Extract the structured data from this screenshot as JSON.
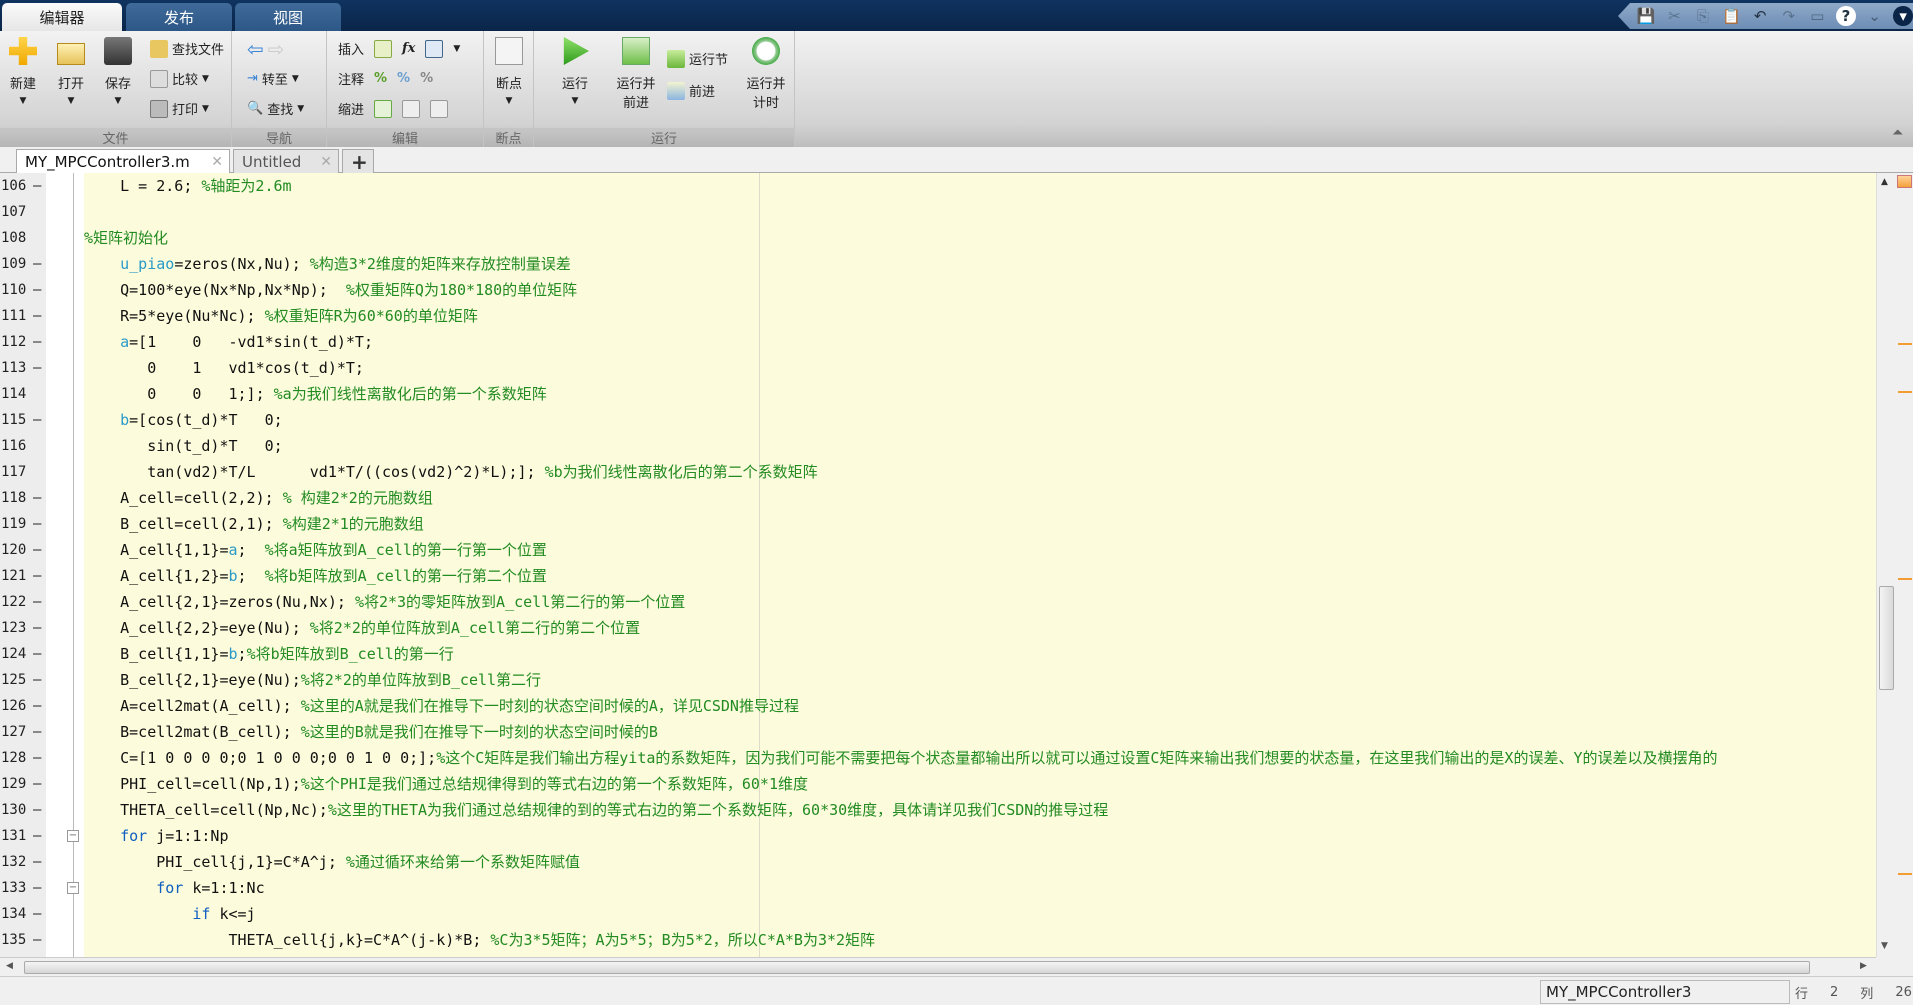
{
  "main_tabs": [
    "编辑器",
    "发布",
    "视图"
  ],
  "ribbon": {
    "file": {
      "label": "文件",
      "new": "新建",
      "open": "打开",
      "save": "保存",
      "find_files": "查找文件",
      "compare": "比较",
      "print": "打印"
    },
    "nav": {
      "label": "导航",
      "goto": "转至",
      "find": "查找"
    },
    "edit": {
      "label": "编辑",
      "insert": "插入",
      "comment": "注释",
      "indent": "缩进",
      "fx": "fx"
    },
    "breakpoints": {
      "label": "断点",
      "breakpoints": "断点"
    },
    "run": {
      "label": "运行",
      "run": "运行",
      "run_advance_1": "运行并",
      "run_advance_2": "前进",
      "run_section": "运行节",
      "advance": "前进",
      "run_time_1": "运行并",
      "run_time_2": "计时"
    }
  },
  "doc_tabs": [
    {
      "label": "MY_MPCController3.m",
      "active": true
    },
    {
      "label": "Untitled",
      "active": false
    }
  ],
  "add_tab": "+",
  "code_lines": [
    {
      "n": "106",
      "dash": true,
      "seg": [
        [
          "    L = 2.6; ",
          "code"
        ],
        [
          "%轴距为2.6m",
          "comment"
        ]
      ]
    },
    {
      "n": "107",
      "dash": false,
      "seg": []
    },
    {
      "n": "108",
      "dash": false,
      "seg": [
        [
          "%矩阵初始化",
          "comment"
        ]
      ]
    },
    {
      "n": "109",
      "dash": true,
      "seg": [
        [
          "    ",
          "code"
        ],
        [
          "u_piao",
          "var"
        ],
        [
          "=zeros(Nx,Nu); ",
          "code"
        ],
        [
          "%构造3*2维度的矩阵来存放控制量误差",
          "comment"
        ]
      ]
    },
    {
      "n": "110",
      "dash": true,
      "seg": [
        [
          "    Q=100*eye(Nx*Np,Nx*Np);  ",
          "code"
        ],
        [
          "%权重矩阵Q为180*180的单位矩阵",
          "comment"
        ]
      ]
    },
    {
      "n": "111",
      "dash": true,
      "seg": [
        [
          "    R=5*eye(Nu*Nc); ",
          "code"
        ],
        [
          "%权重矩阵R为60*60的单位矩阵",
          "comment"
        ]
      ]
    },
    {
      "n": "112",
      "dash": true,
      "seg": [
        [
          "    ",
          "code"
        ],
        [
          "a",
          "var"
        ],
        [
          "=[1    0   -vd1*sin(t_d)*T;",
          "code"
        ]
      ]
    },
    {
      "n": "113",
      "dash": true,
      "seg": [
        [
          "       0    1   vd1*cos(t_d)*T;",
          "code"
        ]
      ]
    },
    {
      "n": "114",
      "dash": false,
      "seg": [
        [
          "       0    0   1;]; ",
          "code"
        ],
        [
          "%a为我们线性离散化后的第一个系数矩阵",
          "comment"
        ]
      ]
    },
    {
      "n": "115",
      "dash": true,
      "seg": [
        [
          "    ",
          "code"
        ],
        [
          "b",
          "var"
        ],
        [
          "=[cos(t_d)*T   0;",
          "code"
        ]
      ]
    },
    {
      "n": "116",
      "dash": false,
      "seg": [
        [
          "       sin(t_d)*T   0;",
          "code"
        ]
      ]
    },
    {
      "n": "117",
      "dash": false,
      "seg": [
        [
          "       tan(vd2)*T/L      vd1*T/((cos(vd2)^2)*L);]; ",
          "code"
        ],
        [
          "%b为我们线性离散化后的第二个系数矩阵",
          "comment"
        ]
      ]
    },
    {
      "n": "118",
      "dash": true,
      "seg": [
        [
          "    A_cell=cell(2,2); ",
          "code"
        ],
        [
          "% 构建2*2的元胞数组",
          "comment"
        ]
      ]
    },
    {
      "n": "119",
      "dash": true,
      "seg": [
        [
          "    B_cell=cell(2,1); ",
          "code"
        ],
        [
          "%构建2*1的元胞数组",
          "comment"
        ]
      ]
    },
    {
      "n": "120",
      "dash": true,
      "seg": [
        [
          "    A_cell{1,1}=",
          "code"
        ],
        [
          "a",
          "var"
        ],
        [
          ";  ",
          "code"
        ],
        [
          "%将a矩阵放到A_cell的第一行第一个位置",
          "comment"
        ]
      ]
    },
    {
      "n": "121",
      "dash": true,
      "seg": [
        [
          "    A_cell{1,2}=",
          "code"
        ],
        [
          "b",
          "var"
        ],
        [
          ";  ",
          "code"
        ],
        [
          "%将b矩阵放到A_cell的第一行第二个位置",
          "comment"
        ]
      ]
    },
    {
      "n": "122",
      "dash": true,
      "seg": [
        [
          "    A_cell{2,1}=zeros(Nu,Nx); ",
          "code"
        ],
        [
          "%将2*3的零矩阵放到A_cell第二行的第一个位置",
          "comment"
        ]
      ]
    },
    {
      "n": "123",
      "dash": true,
      "seg": [
        [
          "    A_cell{2,2}=eye(Nu); ",
          "code"
        ],
        [
          "%将2*2的单位阵放到A_cell第二行的第二个位置",
          "comment"
        ]
      ]
    },
    {
      "n": "124",
      "dash": true,
      "seg": [
        [
          "    B_cell{1,1}=",
          "code"
        ],
        [
          "b",
          "var"
        ],
        [
          ";",
          "code"
        ],
        [
          "%将b矩阵放到B_cell的第一行",
          "comment"
        ]
      ]
    },
    {
      "n": "125",
      "dash": true,
      "seg": [
        [
          "    B_cell{2,1}=eye(Nu);",
          "code"
        ],
        [
          "%将2*2的单位阵放到B_cell第二行",
          "comment"
        ]
      ]
    },
    {
      "n": "126",
      "dash": true,
      "seg": [
        [
          "    A=cell2mat(A_cell); ",
          "code"
        ],
        [
          "%这里的A就是我们在推导下一时刻的状态空间时候的A，详见CSDN推导过程",
          "comment"
        ]
      ]
    },
    {
      "n": "127",
      "dash": true,
      "seg": [
        [
          "    B=cell2mat(B_cell); ",
          "code"
        ],
        [
          "%这里的B就是我们在推导下一时刻的状态空间时候的B",
          "comment"
        ]
      ]
    },
    {
      "n": "128",
      "dash": true,
      "seg": [
        [
          "    C=[1 0 0 0 0;0 1 0 0 0;0 0 1 0 0;];",
          "code"
        ],
        [
          "%这个C矩阵是我们输出方程yita的系数矩阵，因为我们可能不需要把每个状态量都输出所以就可以通过设置C矩阵来输出我们想要的状态量，在这里我们输出的是X的误差、Y的误差以及横摆角的",
          "comment"
        ]
      ]
    },
    {
      "n": "129",
      "dash": true,
      "seg": [
        [
          "    PHI_cell=cell(Np,1);",
          "code"
        ],
        [
          "%这个PHI是我们通过总结规律得到的等式右边的第一个系数矩阵，60*1维度",
          "comment"
        ]
      ]
    },
    {
      "n": "130",
      "dash": true,
      "seg": [
        [
          "    THETA_cell=cell(Np,Nc);",
          "code"
        ],
        [
          "%这里的THETA为我们通过总结规律的到的等式右边的第二个系数矩阵，60*30维度，具体请详见我们CSDN的推导过程",
          "comment"
        ]
      ]
    },
    {
      "n": "131",
      "dash": true,
      "fold": true,
      "seg": [
        [
          "    ",
          "code"
        ],
        [
          "for",
          "kw"
        ],
        [
          " j=1:1:Np",
          "code"
        ]
      ]
    },
    {
      "n": "132",
      "dash": true,
      "seg": [
        [
          "        PHI_cell{j,1}=C*A^j; ",
          "code"
        ],
        [
          "%通过循环来给第一个系数矩阵赋值",
          "comment"
        ]
      ]
    },
    {
      "n": "133",
      "dash": true,
      "fold": true,
      "seg": [
        [
          "        ",
          "code"
        ],
        [
          "for",
          "kw"
        ],
        [
          " k=1:1:Nc",
          "code"
        ]
      ]
    },
    {
      "n": "134",
      "dash": true,
      "seg": [
        [
          "            ",
          "code"
        ],
        [
          "if",
          "kw"
        ],
        [
          " k<=j",
          "code"
        ]
      ]
    },
    {
      "n": "135",
      "dash": true,
      "seg": [
        [
          "                THETA_cell{j,k}=C*A^(j-k)*B; ",
          "code"
        ],
        [
          "%C为3*5矩阵；A为5*5；B为5*2，所以C*A*B为3*2矩阵",
          "comment"
        ]
      ]
    }
  ],
  "status": {
    "file": "MY_MPCController3",
    "row_label": "行",
    "row": "2",
    "col_label": "列",
    "col": "26"
  },
  "colors": {
    "editor_bg": "#fcfbdb",
    "comment": "#228b22",
    "keyword": "#0e5fc0",
    "variable": "#2a9ac8"
  }
}
